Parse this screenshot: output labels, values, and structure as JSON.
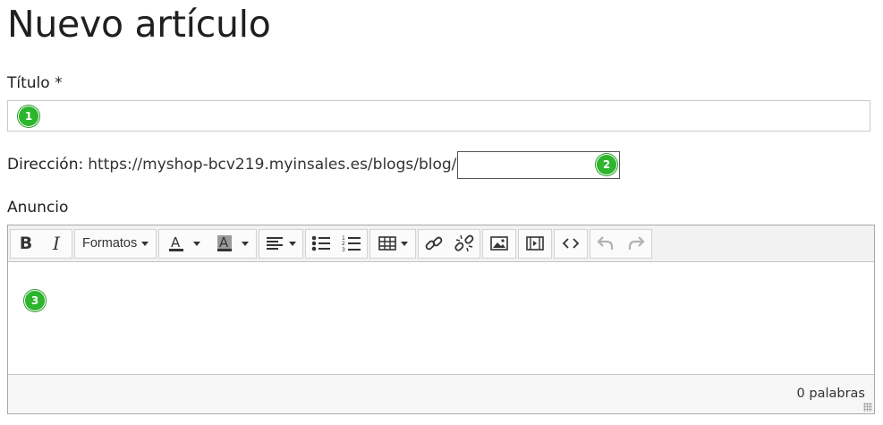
{
  "page": {
    "title": "Nuevo artículo"
  },
  "form": {
    "title_label": "Título *",
    "title_value": "",
    "address_label": "Dirección",
    "address_colon": ":",
    "address_url": "https://myshop-bcv219.myinsales.es/blogs/blog/",
    "slug_value": "",
    "announce_label": "Anuncio"
  },
  "badges": {
    "one": "1",
    "two": "2",
    "three": "3"
  },
  "editor": {
    "formats_label": "Formatos",
    "word_count": "0 palabras",
    "toolbar_icons": [
      "bold-icon",
      "italic-icon",
      "text-color-icon",
      "background-color-icon",
      "align-left-icon",
      "bullet-list-icon",
      "numbered-list-icon",
      "table-icon",
      "link-icon",
      "unlink-icon",
      "image-icon",
      "video-icon",
      "source-code-icon",
      "undo-icon",
      "redo-icon"
    ]
  },
  "colors": {
    "badge": "#2db52d",
    "toolbar_bg": "#f2f2f2",
    "statusbar_bg": "#f7f7f7"
  }
}
